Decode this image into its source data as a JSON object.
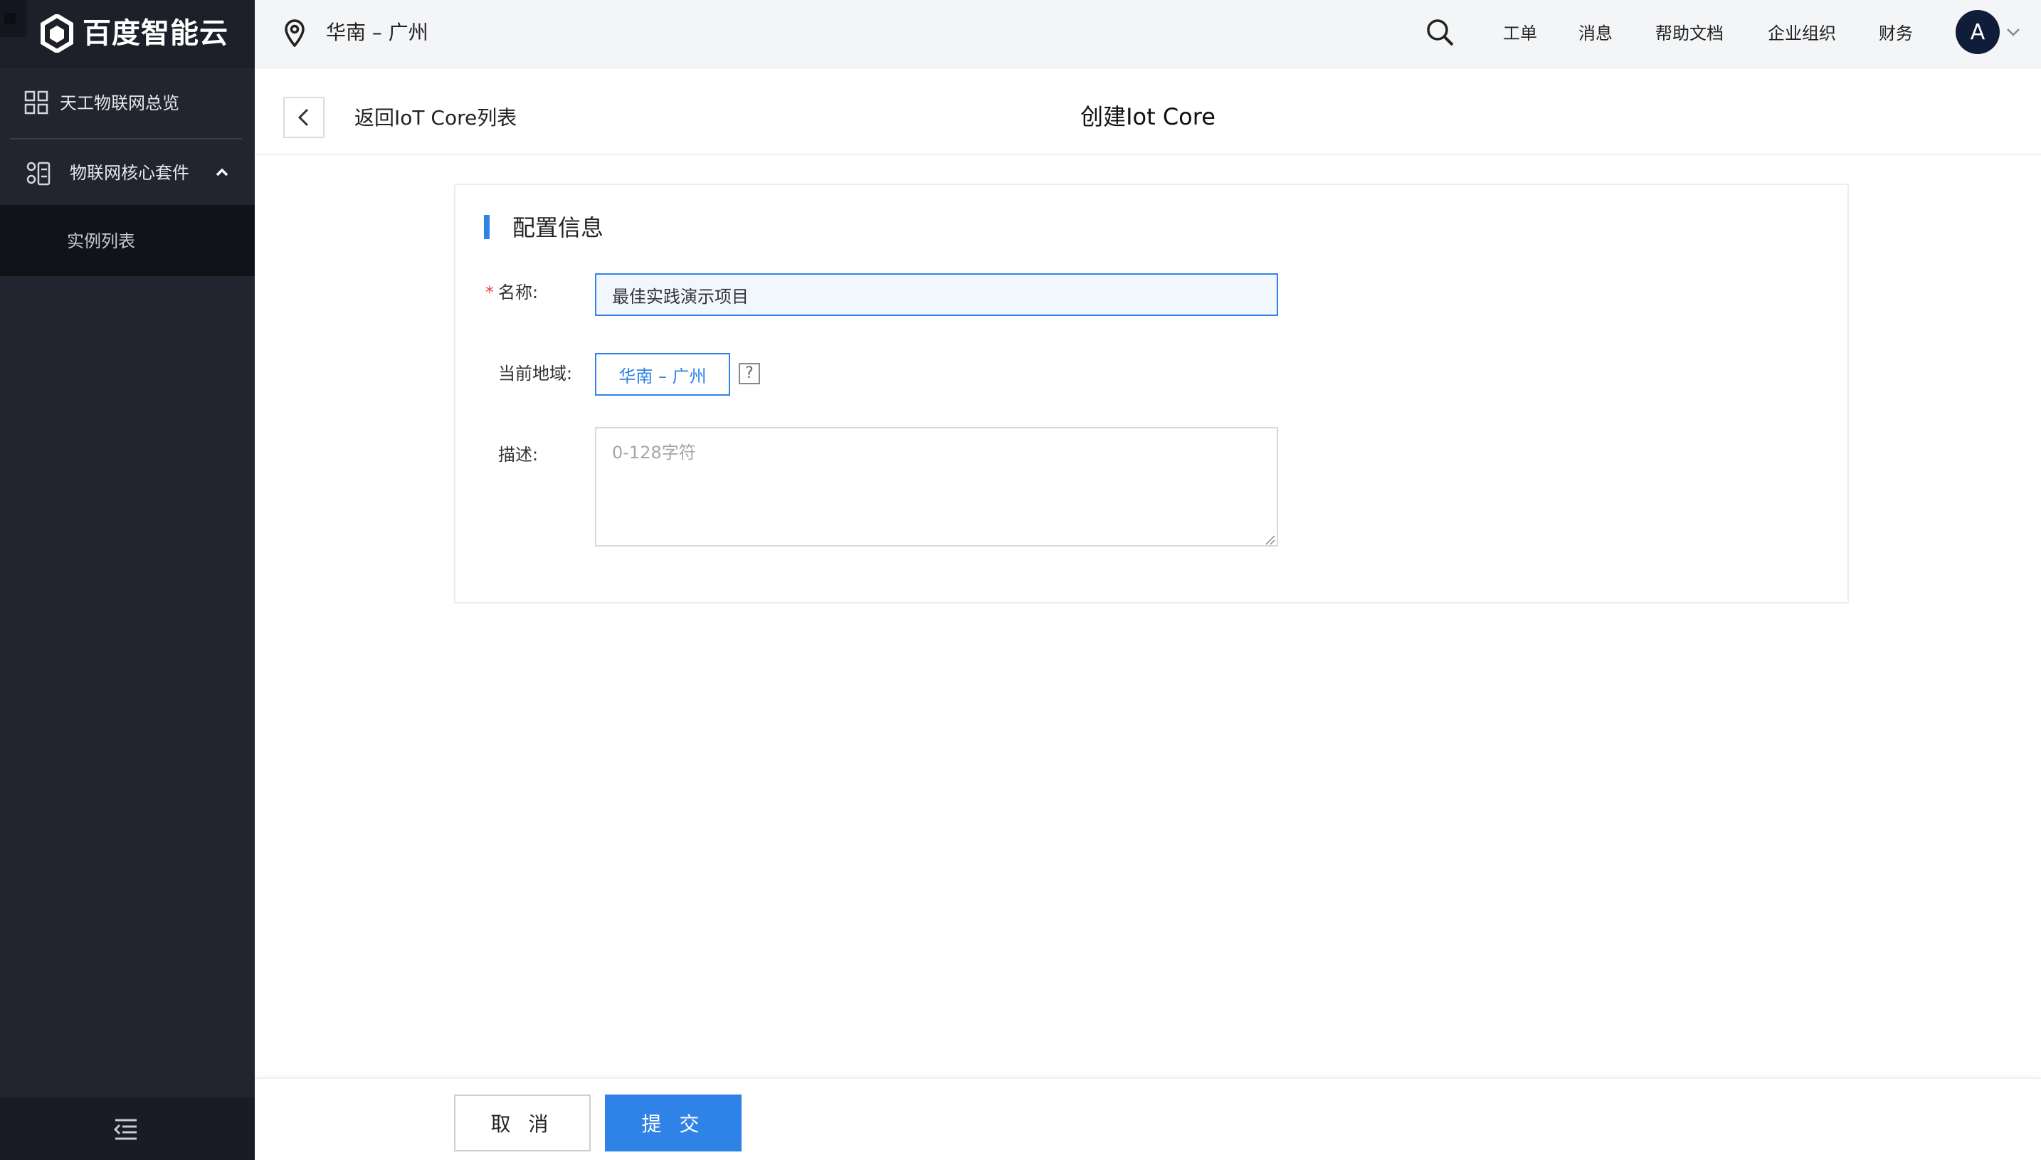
{
  "brand": {
    "logo_text": "百度智能云"
  },
  "sidebar": {
    "overview_label": "天工物联网总览",
    "core_suite_label": "物联网核心套件",
    "sub_items": [
      {
        "label": "实例列表"
      }
    ]
  },
  "topbar": {
    "region": "华南 – 广州",
    "links": [
      "工单",
      "消息",
      "帮助文档",
      "企业组织",
      "财务"
    ],
    "avatar_initial": "A"
  },
  "page_header": {
    "back_label": "返回IoT Core列表",
    "title": "创建Iot Core"
  },
  "form": {
    "section_title": "配置信息",
    "required_mark": "*",
    "name": {
      "label": "名称:",
      "value": "最佳实践演示项目"
    },
    "region": {
      "label": "当前地域:",
      "value": "华南 – 广州",
      "help": "?"
    },
    "description": {
      "label": "描述:",
      "placeholder": "0-128字符",
      "value": ""
    }
  },
  "footer": {
    "cancel_label": "取 消",
    "submit_label": "提 交"
  },
  "colors": {
    "accent": "#2f82e6",
    "sidebar_bg": "#22242f",
    "required": "#e54545"
  }
}
